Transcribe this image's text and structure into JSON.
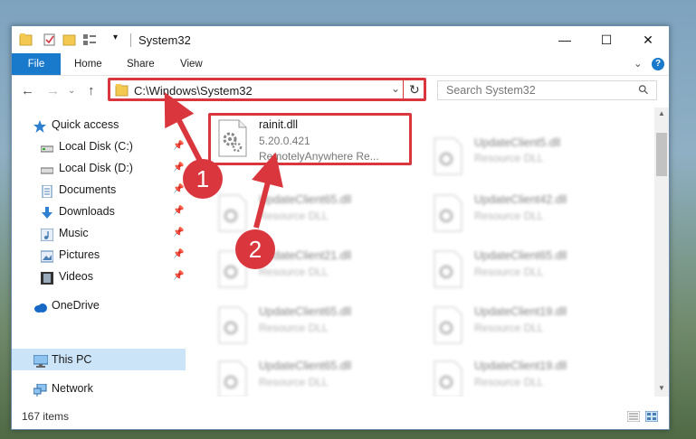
{
  "titlebar": {
    "title": "System32",
    "minimize_glyph": "—",
    "maximize_glyph": "☐",
    "close_glyph": "✕"
  },
  "ribbon": {
    "tabs": [
      {
        "label": "File"
      },
      {
        "label": "Home"
      },
      {
        "label": "Share"
      },
      {
        "label": "View"
      }
    ],
    "expand_glyph": "⌄",
    "help_glyph": "?"
  },
  "navigation": {
    "back_glyph": "←",
    "forward_glyph": "→",
    "recent_glyph": "⌄",
    "up_glyph": "↑",
    "address": "C:\\Windows\\System32",
    "dropdown_glyph": "⌄",
    "refresh_glyph": "↻",
    "search_placeholder": "Search System32",
    "search_glyph": "⚲"
  },
  "sidebar": {
    "items": [
      {
        "label": "Quick access",
        "icon": "star-icon",
        "pinned": false
      },
      {
        "label": "Local Disk (C:)",
        "icon": "drive-icon",
        "pinned": true
      },
      {
        "label": "Local Disk (D:)",
        "icon": "drive-icon",
        "pinned": true
      },
      {
        "label": "Documents",
        "icon": "document-icon",
        "pinned": true
      },
      {
        "label": "Downloads",
        "icon": "download-arrow-icon",
        "pinned": true
      },
      {
        "label": "Music",
        "icon": "music-note-icon",
        "pinned": true
      },
      {
        "label": "Pictures",
        "icon": "pictures-icon",
        "pinned": true
      },
      {
        "label": "Videos",
        "icon": "film-icon",
        "pinned": true
      },
      {
        "label": "OneDrive",
        "icon": "cloud-icon",
        "pinned": false
      },
      {
        "label": "This PC",
        "icon": "monitor-icon",
        "pinned": false,
        "selected": true
      },
      {
        "label": "Network",
        "icon": "network-icon",
        "pinned": false
      }
    ],
    "pin_glyph": "📌"
  },
  "files": [
    {
      "name": "rainit.dll",
      "version": "5.20.0.421",
      "description": "RemotelyAnywhere Re...",
      "highlighted": true
    },
    {
      "name": "UpdateClient5.dll",
      "type": "Resource DLL"
    },
    {
      "name": "UpdateClient65.dll",
      "type": "Resource DLL"
    },
    {
      "name": "UpdateClient42.dll",
      "type": "Resource DLL"
    },
    {
      "name": "UpdateClient21.dll",
      "type": "Resource DLL"
    },
    {
      "name": "UpdateClient65.dll",
      "type": "Resource DLL"
    },
    {
      "name": "UpdateClient65.dll",
      "type": "Resource DLL"
    },
    {
      "name": "UpdateClient19.dll",
      "type": "Resource DLL"
    },
    {
      "name": "UpdateClient65.dll",
      "type": "Resource DLL"
    },
    {
      "name": "UpdateClient19.dll",
      "type": "Resource DLL"
    }
  ],
  "status": {
    "item_count": "167 items"
  },
  "annotations": {
    "step1": "1",
    "step2": "2",
    "color": "#d9363e"
  },
  "colors": {
    "accent": "#1979ca",
    "selection": "#cce4f7",
    "highlight_border": "#d9363e"
  }
}
